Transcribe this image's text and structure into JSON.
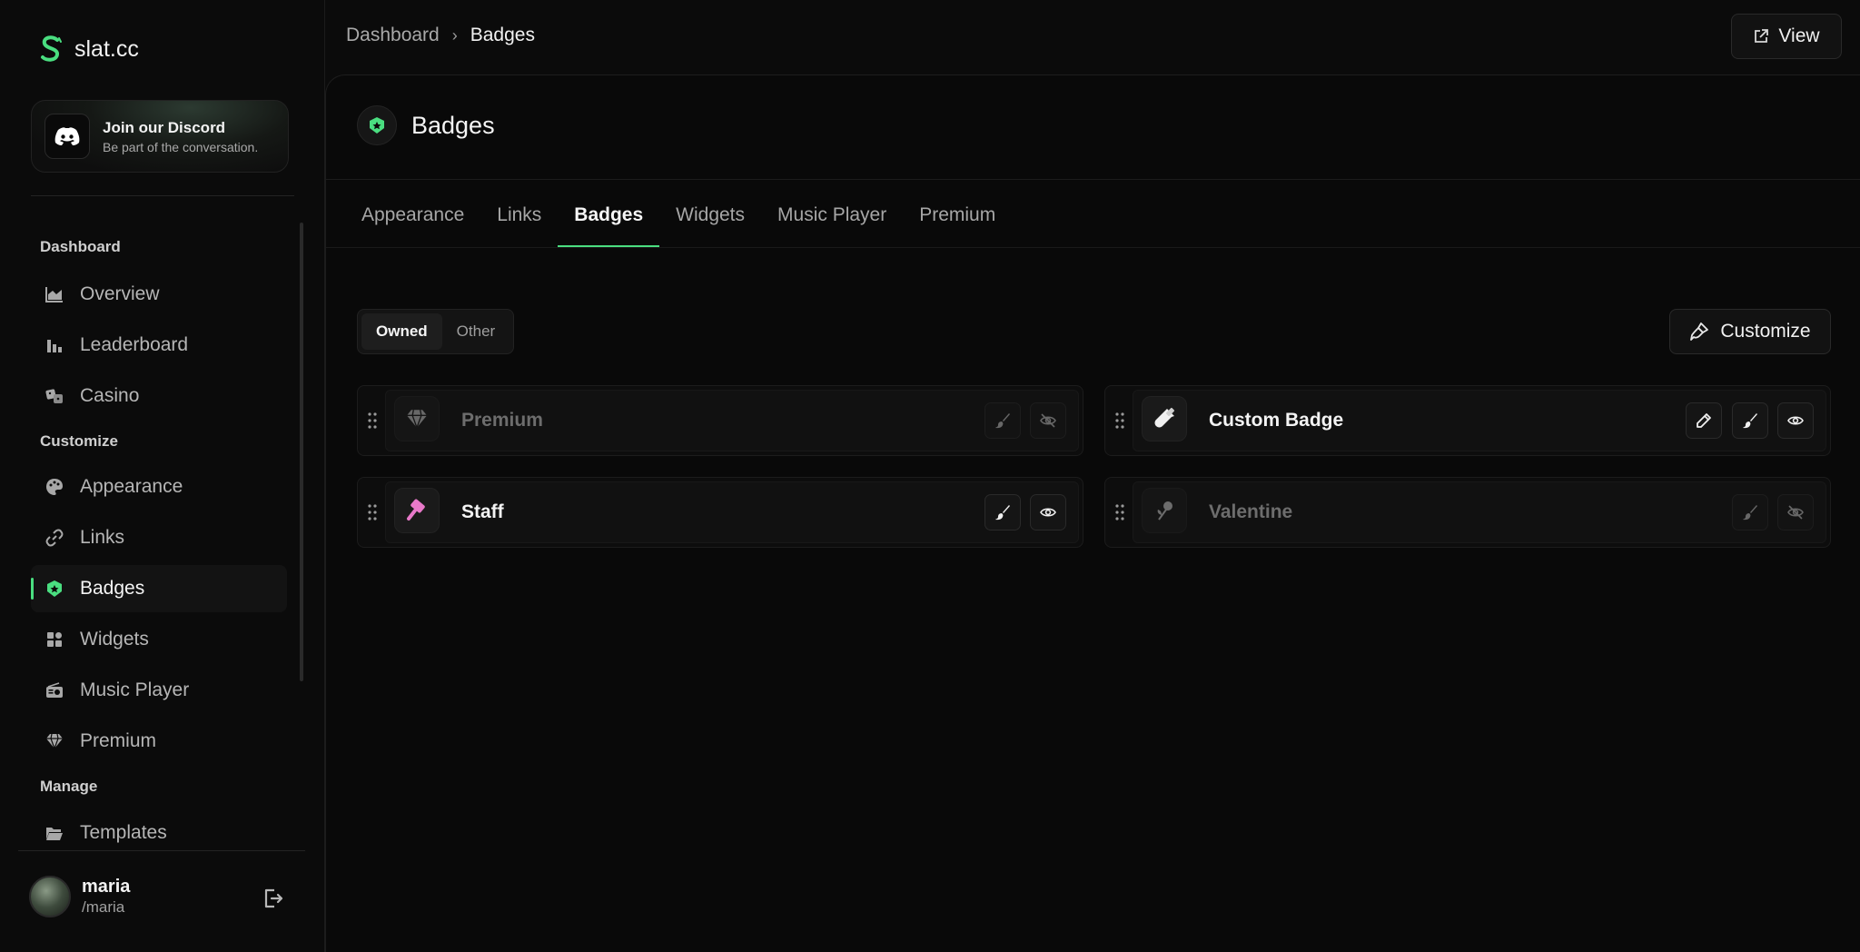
{
  "app": {
    "name": "slat.cc"
  },
  "discord": {
    "title": "Join our Discord",
    "subtitle": "Be part of the conversation."
  },
  "sidebar": {
    "sections": [
      "Dashboard",
      "Customize",
      "Manage"
    ],
    "items": [
      {
        "label": "Overview",
        "icon": "chart-area-icon"
      },
      {
        "label": "Leaderboard",
        "icon": "bar-chart-icon"
      },
      {
        "label": "Casino",
        "icon": "dice-icon"
      },
      {
        "label": "Appearance",
        "icon": "palette-icon"
      },
      {
        "label": "Links",
        "icon": "link-icon"
      },
      {
        "label": "Badges",
        "icon": "shield-icon",
        "active": true
      },
      {
        "label": "Widgets",
        "icon": "widgets-icon"
      },
      {
        "label": "Music Player",
        "icon": "radio-icon"
      },
      {
        "label": "Premium",
        "icon": "gem-icon"
      },
      {
        "label": "Templates",
        "icon": "folder-icon"
      }
    ]
  },
  "user": {
    "name": "maria",
    "handle": "/maria"
  },
  "breadcrumb": {
    "parent": "Dashboard",
    "current": "Badges"
  },
  "header": {
    "view_label": "View"
  },
  "page": {
    "title": "Badges"
  },
  "tabs": [
    "Appearance",
    "Links",
    "Badges",
    "Widgets",
    "Music Player",
    "Premium"
  ],
  "active_tab": "Badges",
  "filter": {
    "owned": "Owned",
    "other": "Other",
    "selected": "Owned"
  },
  "customize_label": "Customize",
  "badges": [
    {
      "name": "Premium",
      "enabled": false,
      "icon": "gem-icon"
    },
    {
      "name": "Custom Badge",
      "enabled": true,
      "icon": "bottle-icon",
      "editable": true
    },
    {
      "name": "Staff",
      "enabled": true,
      "icon": "hammer-icon"
    },
    {
      "name": "Valentine",
      "enabled": false,
      "icon": "rose-icon"
    }
  ],
  "colors": {
    "accent": "#4ade80",
    "background": "#0b0b0b",
    "staff_pink": "#e879c9"
  }
}
